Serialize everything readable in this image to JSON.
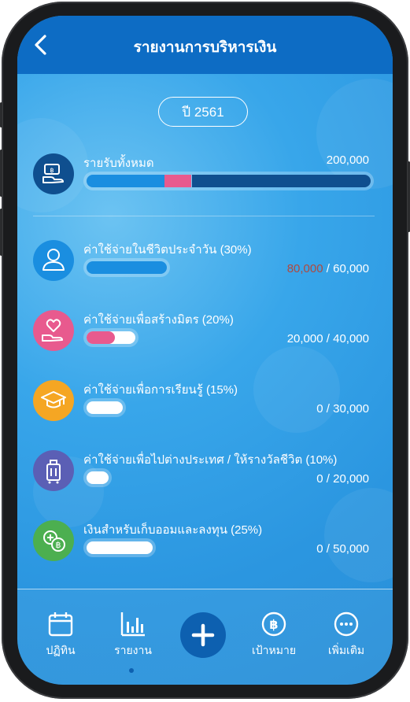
{
  "header": {
    "title": "รายงานการบริหารเงิน"
  },
  "year_selector": {
    "label": "ปี 2561"
  },
  "total_income": {
    "label": "รายรับทั้งหมด",
    "amount": "200,000",
    "icon": "money-hand-icon",
    "segments": [
      {
        "from": 0,
        "to": 0.275,
        "color": "#1a8ee0"
      },
      {
        "from": 0.275,
        "to": 0.37,
        "color": "#e85a8e"
      },
      {
        "from": 0.37,
        "to": 1.0,
        "color": "#0f4f8f"
      }
    ]
  },
  "categories": [
    {
      "label": "ค่าใช้จ่ายในชีวิตประจำวัน (30%)",
      "spent": "80,000",
      "separator": " / ",
      "budget": "60,000",
      "over": true,
      "icon": "person-icon",
      "color": "#1a8ee0",
      "bar_color": "#1a8ee0"
    },
    {
      "label": "ค่าใช้จ่ายเพื่อสร้างมิตร (20%)",
      "spent": "20,000",
      "separator": " / ",
      "budget": "40,000",
      "over": false,
      "icon": "heart-hand-icon",
      "color": "#e85a8e",
      "bar_color": "#e85a8e"
    },
    {
      "label": "ค่าใช้จ่ายเพื่อการเรียนรู้ (15%)",
      "spent": "0",
      "separator": " / ",
      "budget": "30,000",
      "over": false,
      "icon": "graduation-cap-icon",
      "color": "#f5a623",
      "bar_color": "#f5a623"
    },
    {
      "label": "ค่าใช้จ่ายเพื่อไปต่างประเทศ / ให้รางวัลชีวิต (10%)",
      "spent": "0",
      "separator": " / ",
      "budget": "20,000",
      "over": false,
      "icon": "luggage-icon",
      "color": "#5b5fb5",
      "bar_color": "#5b5fb5"
    },
    {
      "label": "เงินสำหรับเก็บออมและลงทุน (25%)",
      "spent": "0",
      "separator": " / ",
      "budget": "50,000",
      "over": false,
      "icon": "coins-icon",
      "color": "#4caf50",
      "bar_color": "#4caf50"
    }
  ],
  "bottom_nav": [
    {
      "label": "ปฏิทิน",
      "icon": "calendar-icon"
    },
    {
      "label": "รายงาน",
      "icon": "bar-chart-icon",
      "active": true
    },
    {
      "label": "",
      "icon": "plus-icon"
    },
    {
      "label": "เป้าหมาย",
      "icon": "baht-coin-icon"
    },
    {
      "label": "เพิ่มเติม",
      "icon": "more-icon"
    }
  ]
}
